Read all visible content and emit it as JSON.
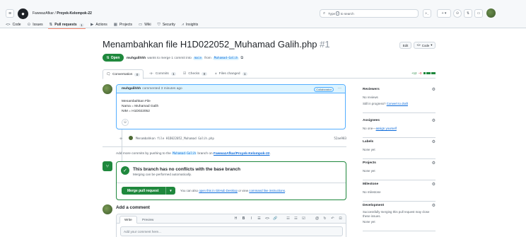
{
  "header": {
    "owner": "FawwazAfkar",
    "separator": " / ",
    "repo": "Proyek-Kelompok-22",
    "search_placeholder": "Type",
    "search_key": "/",
    "search_suffix": "to search",
    "cmd_label": ">_",
    "plus_label": "+ ▾",
    "icons": [
      "hamburger-icon",
      "github-logo",
      "search-icon",
      "command-palette-icon",
      "plus-icon",
      "issues-icon",
      "pull-requests-icon",
      "inbox-icon",
      "avatar"
    ]
  },
  "repo_nav": {
    "tabs": [
      {
        "label": "Code",
        "icon": "<>"
      },
      {
        "label": "Issues",
        "icon": "⊙"
      },
      {
        "label": "Pull requests",
        "icon": "⇅",
        "count": "1"
      },
      {
        "label": "Actions",
        "icon": "▶"
      },
      {
        "label": "Projects",
        "icon": "▦"
      },
      {
        "label": "Wiki",
        "icon": "▭"
      },
      {
        "label": "Security",
        "icon": "⛉"
      },
      {
        "label": "Insights",
        "icon": "⩘"
      }
    ]
  },
  "pr": {
    "title": "Menambahkan file H1D022052_Muhamad Galih.php",
    "number": "#1",
    "edit_label": "Edit",
    "code_label": "Code",
    "status": "Open",
    "author": "muhgalihhh",
    "wants_text": "wants to merge 1 commit into",
    "base_branch": "main",
    "from_text": "from",
    "head_branch": "Muhamad-Galih"
  },
  "pr_tabs": [
    {
      "label": "Conversation",
      "count": "0",
      "icon": "🗨"
    },
    {
      "label": "Commits",
      "count": "1",
      "icon": "-o-"
    },
    {
      "label": "Checks",
      "count": "0",
      "icon": "☑"
    },
    {
      "label": "Files changed",
      "count": "1",
      "icon": "±"
    }
  ],
  "diffstat": {
    "additions": "+12",
    "deletions": "−0"
  },
  "comment": {
    "author": "muhgalihhh",
    "time": "commented 3 minutes ago",
    "role": "Collaborator",
    "menu": "···",
    "lines": [
      "Menambahkan File",
      "Nama = Muhamad Galih",
      "NIM = H1D022052"
    ]
  },
  "commit": {
    "message": "Menambahkan file H1D022052_Muhamad Galih.php",
    "sha": "52ae983"
  },
  "add_more": {
    "prefix": "Add more commits by pushing to the",
    "branch": "Muhamad-Galih",
    "middle": "branch on",
    "repo": "FawwazAfkar/Proyek-Kelompok-22",
    "suffix": "."
  },
  "merge": {
    "title": "This branch has no conflicts with the base branch",
    "subtitle": "Merging can be performed automatically.",
    "button": "Merge pull request",
    "also_prefix": "You can also",
    "desktop_link": "open this in GitHub Desktop",
    "or_text": "or view",
    "cli_link": "command line instructions",
    "end": "."
  },
  "new_comment": {
    "heading": "Add a comment",
    "write_tab": "Write",
    "preview_tab": "Preview",
    "placeholder": "Add your comment here...",
    "tools": [
      "H",
      "B",
      "I",
      "☰",
      "<>",
      "🔗",
      "☷",
      "☷",
      "☑",
      "@",
      "↻",
      "↶",
      "⊡"
    ]
  },
  "sidebar": {
    "reviewers": {
      "title": "Reviewers",
      "value": "No reviews",
      "note_prefix": "Still in progress?",
      "note_link": "Convert to draft"
    },
    "assignees": {
      "title": "Assignees",
      "prefix": "No one—",
      "link": "assign yourself"
    },
    "labels": {
      "title": "Labels",
      "value": "None yet"
    },
    "projects": {
      "title": "Projects",
      "value": "None yet"
    },
    "milestone": {
      "title": "Milestone",
      "value": "No milestone"
    },
    "development": {
      "title": "Development",
      "note": "Successfully merging this pull request may close these issues.",
      "value": "None yet"
    }
  },
  "colors": {
    "accent_green": "#1f883d",
    "link_blue": "#0969da",
    "tab_underline": "#fd8c73"
  }
}
